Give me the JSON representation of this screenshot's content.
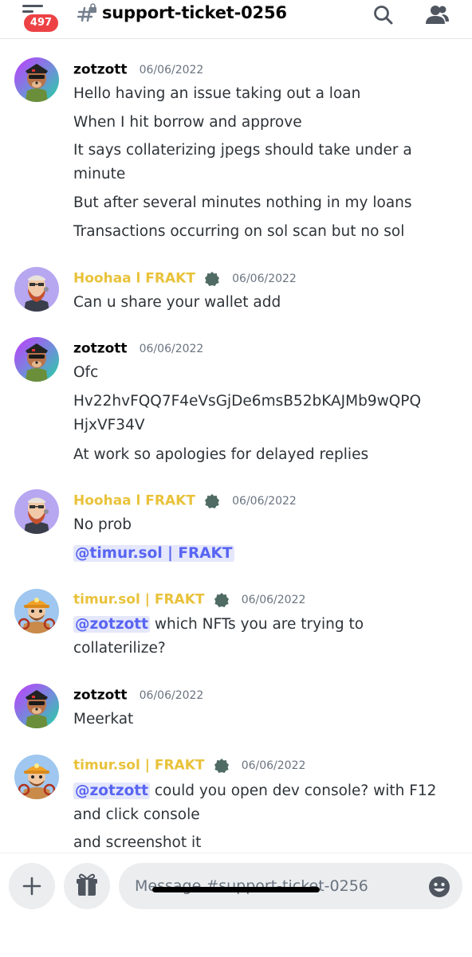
{
  "header": {
    "unread_badge": "497",
    "channel_name": "support-ticket-0256",
    "icons": [
      "menu-icon",
      "hashtag-lock-icon",
      "search-icon",
      "members-icon"
    ]
  },
  "messages": [
    {
      "author": "zotzott",
      "timestamp": "06/06/2022",
      "is_mod": false,
      "avatar": "meerkat-avatar",
      "lines": [
        "Hello having an issue taking out a loan",
        "When I hit borrow and approve",
        "It says collaterizing jpegs should take under a",
        "minute",
        "But after several minutes nothing in my loans",
        "Transactions occurring on sol scan but no sol"
      ]
    },
    {
      "author": "Hoohaa l FRAKT",
      "timestamp": "06/06/2022",
      "is_mod": true,
      "avatar": "bearded-man-avatar",
      "lines": [
        "Can u share your wallet add"
      ]
    },
    {
      "author": "zotzott",
      "timestamp": "06/06/2022",
      "is_mod": false,
      "avatar": "meerkat-avatar",
      "lines": [
        "Ofc",
        "Hv22hvFQQ7F4eVsGjDe6msB52bKAJMb9wQPQ",
        "HjxVF34V",
        "At work so apologies for delayed replies"
      ]
    },
    {
      "author": "Hoohaa l FRAKT",
      "timestamp": "06/06/2022",
      "is_mod": true,
      "avatar": "bearded-man-avatar",
      "lines": [
        "No prob"
      ],
      "mention_line": "@timur.sol | FRAKT"
    },
    {
      "author": "timur.sol | FRAKT",
      "timestamp": "06/06/2022",
      "is_mod": true,
      "avatar": "miner-avatar",
      "mention": "@zotzott",
      "lines": [
        " which NFTs you are trying to",
        "collaterilize?"
      ]
    },
    {
      "author": "zotzott",
      "timestamp": "06/06/2022",
      "is_mod": false,
      "avatar": "meerkat-avatar",
      "lines": [
        "Meerkat"
      ]
    },
    {
      "author": "timur.sol | FRAKT",
      "timestamp": "06/06/2022",
      "is_mod": true,
      "avatar": "miner-avatar",
      "mention": "@zotzott",
      "lines": [
        " could you open dev console? with F12",
        "and click console",
        "and screenshot it"
      ]
    }
  ],
  "composer": {
    "placeholder": "Message #support-ticket-0256",
    "icons": [
      "plus-icon",
      "gift-icon",
      "emoji-icon"
    ]
  },
  "colors": {
    "mod_name": "#e9c23a",
    "mention_text": "#5865f2",
    "mention_bg": "#e5e7fb",
    "badge": "#ed4245"
  }
}
